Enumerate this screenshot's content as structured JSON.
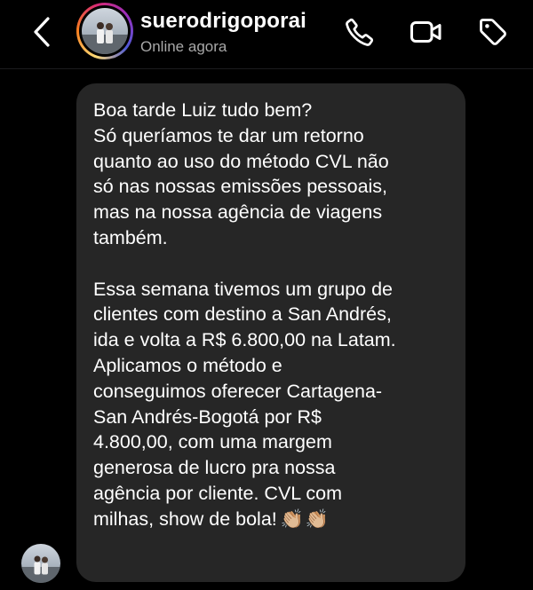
{
  "header": {
    "username": "suerodrigoporai",
    "status": "Online agora",
    "icons": [
      "chevron-left-icon",
      "phone-icon",
      "video-camera-icon",
      "tag-icon"
    ]
  },
  "message": {
    "lines": [
      "Boa tarde Luiz tudo bem?",
      "Só queríamos te dar um retorno",
      "quanto ao uso do método CVL não",
      "só nas nossas emissões pessoais,",
      "mas na nossa agência de viagens",
      "também.",
      "",
      "Essa semana tivemos um grupo de",
      "clientes com destino a San Andrés,",
      "ida e volta a R$ 6.800,00 na Latam.",
      "Aplicamos o método e",
      "conseguimos oferecer Cartagena-",
      "San Andrés-Bogotá por R$",
      "4.800,00, com uma margem",
      "generosa de lucro pra nossa",
      "agência por cliente. CVL com",
      "milhas, show de bola!"
    ],
    "emoji": "👏🏼👏🏼"
  },
  "colors": {
    "background": "#000000",
    "bubble": "#262626",
    "status_text": "#a8a8a8"
  }
}
